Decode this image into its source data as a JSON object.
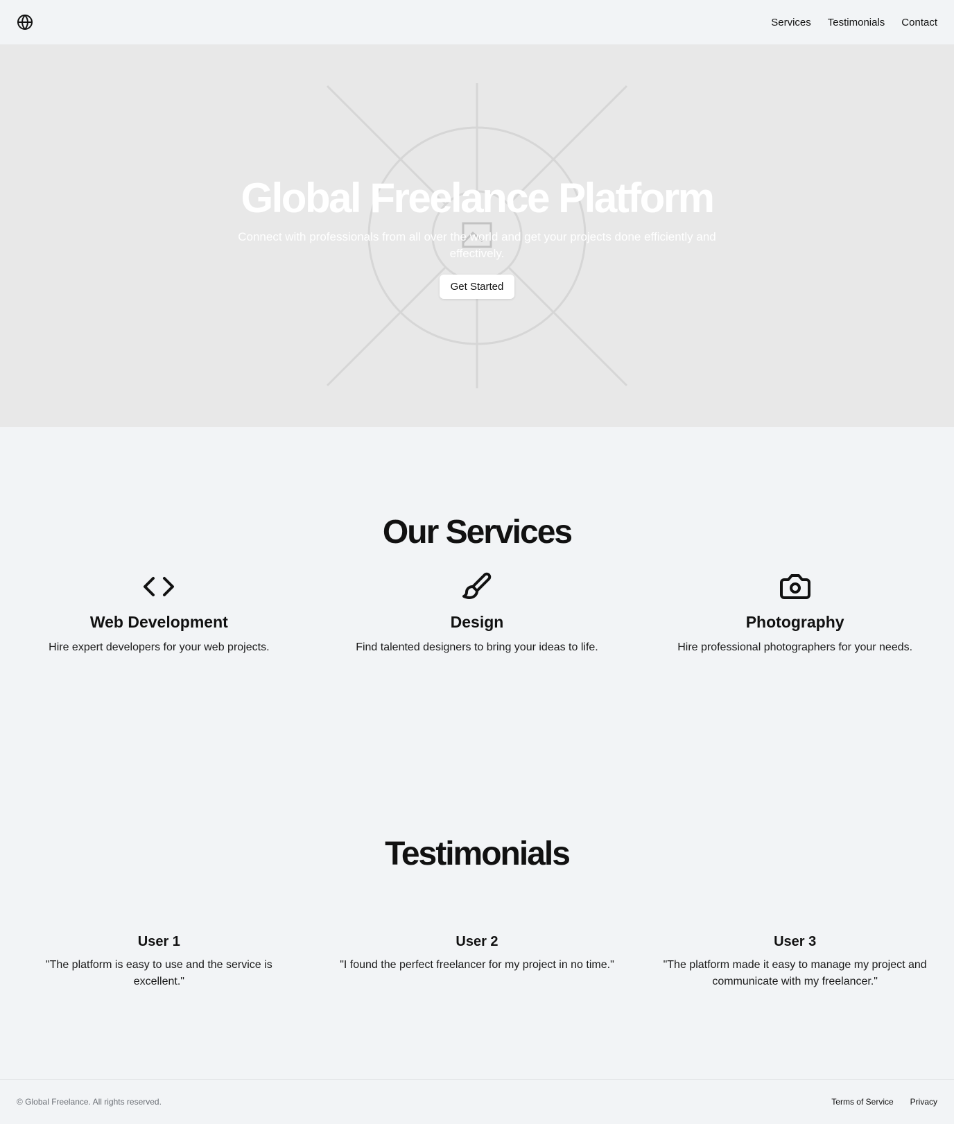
{
  "header": {
    "logo_icon": "globe-icon",
    "nav": {
      "services": "Services",
      "testimonials": "Testimonials",
      "contact": "Contact"
    }
  },
  "hero": {
    "title": "Global Freelance Platform",
    "subtitle": "Connect with professionals from all over the world and get your projects done efficiently and effectively.",
    "cta_label": "Get Started",
    "background_icon": "image-placeholder-icon"
  },
  "services": {
    "heading": "Our Services",
    "items": [
      {
        "icon": "code-icon",
        "title": "Web Development",
        "description": "Hire expert developers for your web projects."
      },
      {
        "icon": "paintbrush-icon",
        "title": "Design",
        "description": "Find talented designers to bring your ideas to life."
      },
      {
        "icon": "camera-icon",
        "title": "Photography",
        "description": "Hire professional photographers for your needs."
      }
    ]
  },
  "testimonials": {
    "heading": "Testimonials",
    "items": [
      {
        "name": "User 1",
        "quote": "\"The platform is easy to use and the service is excellent.\""
      },
      {
        "name": "User 2",
        "quote": "\"I found the perfect freelancer for my project in no time.\""
      },
      {
        "name": "User 3",
        "quote": "\"The platform made it easy to manage my project and communicate with my freelancer.\""
      }
    ]
  },
  "footer": {
    "copyright": "© Global Freelance. All rights reserved.",
    "links": {
      "terms": "Terms of Service",
      "privacy": "Privacy"
    }
  },
  "colors": {
    "page_bg": "#f2f4f6",
    "hero_bg": "#e8e8e8",
    "text": "#111111",
    "muted": "#6b6f75"
  }
}
